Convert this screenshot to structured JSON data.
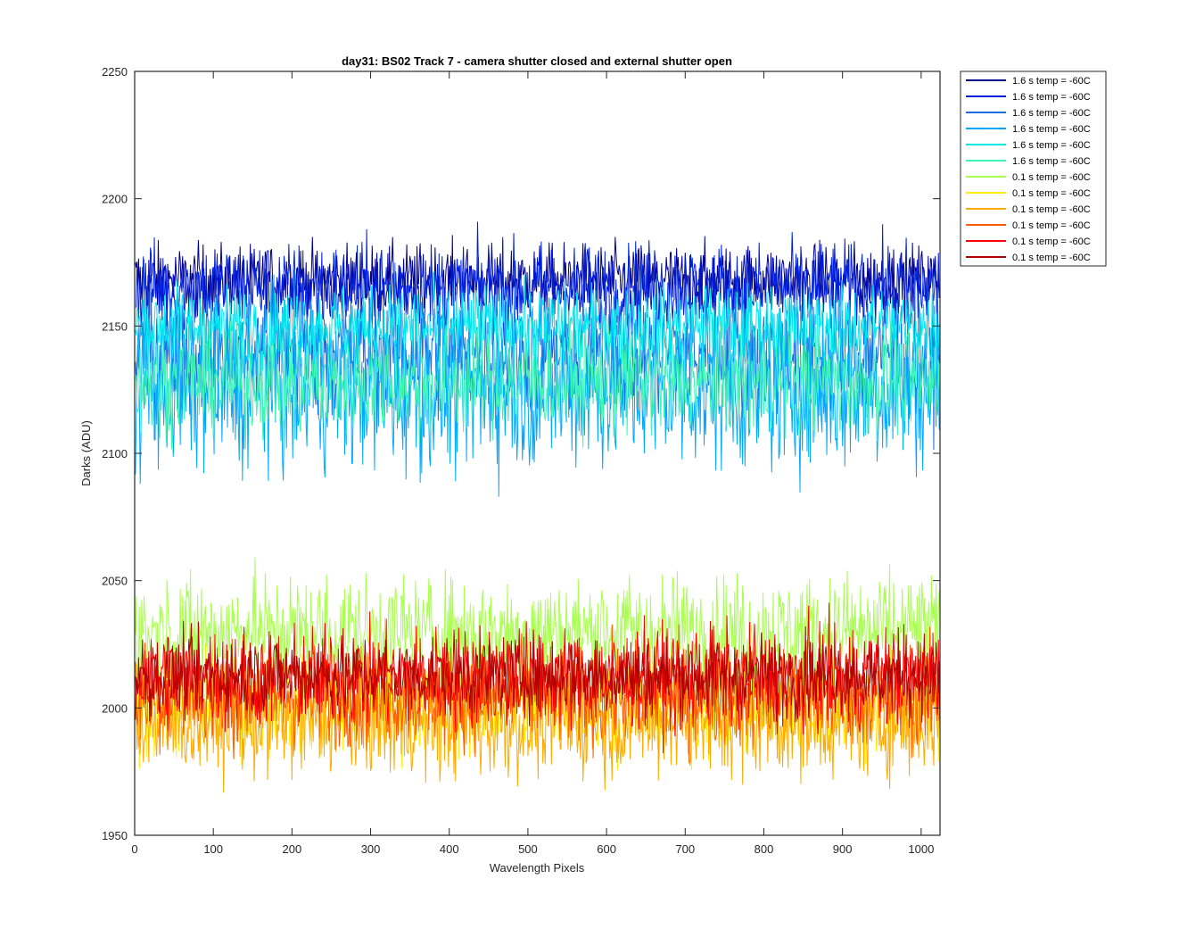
{
  "chart_data": {
    "type": "line",
    "title": "day31: BS02  Track 7 - camera shutter closed and external shutter open",
    "xlabel": "Wavelength Pixels",
    "ylabel": "Darks (ADU)",
    "xlim": [
      0,
      1024
    ],
    "ylim": [
      1950,
      2250
    ],
    "xticks": [
      0,
      100,
      200,
      300,
      400,
      500,
      600,
      700,
      800,
      900,
      1000
    ],
    "yticks": [
      1950,
      2000,
      2050,
      2100,
      2150,
      2200,
      2250
    ],
    "grid": false,
    "legend_position": "outside-top-right",
    "series": [
      {
        "name": "1.6 s temp = -60C",
        "color": "#00008f",
        "mean": 2168,
        "noise": 7,
        "min": 2148,
        "max": 2202
      },
      {
        "name": "1.6 s temp = -60C",
        "color": "#0020e0",
        "mean": 2165,
        "noise": 9,
        "min": 2095,
        "max": 2204
      },
      {
        "name": "1.6 s temp = -60C",
        "color": "#1a6fe0",
        "mean": 2140,
        "noise": 13,
        "min": 2090,
        "max": 2185
      },
      {
        "name": "1.6 s temp = -60C",
        "color": "#00aaff",
        "mean": 2125,
        "noise": 16,
        "min": 2066,
        "max": 2175
      },
      {
        "name": "1.6 s temp = -60C",
        "color": "#00e8ee",
        "mean": 2150,
        "noise": 8,
        "min": 2055,
        "max": 2185
      },
      {
        "name": "1.6 s temp = -60C",
        "color": "#3ff5b4",
        "mean": 2128,
        "noise": 10,
        "min": 2085,
        "max": 2165
      },
      {
        "name": "0.1 s temp = -60C",
        "color": "#a8ff50",
        "mean": 2030,
        "noise": 11,
        "min": 2005,
        "max": 2072
      },
      {
        "name": "0.1 s temp = -60C",
        "color": "#ffee00",
        "mean": 2002,
        "noise": 10,
        "min": 1965,
        "max": 2045
      },
      {
        "name": "0.1 s temp = -60C",
        "color": "#ffaa00",
        "mean": 1995,
        "noise": 11,
        "min": 1950,
        "max": 2050
      },
      {
        "name": "0.1 s temp = -60C",
        "color": "#ff5a00",
        "mean": 2005,
        "noise": 10,
        "min": 1975,
        "max": 2055
      },
      {
        "name": "0.1 s temp = -60C",
        "color": "#ff0000",
        "mean": 2012,
        "noise": 10,
        "min": 1975,
        "max": 2060
      },
      {
        "name": "0.1 s temp = -60C",
        "color": "#b00000",
        "mean": 2013,
        "noise": 8,
        "min": 1973,
        "max": 2055
      }
    ]
  }
}
